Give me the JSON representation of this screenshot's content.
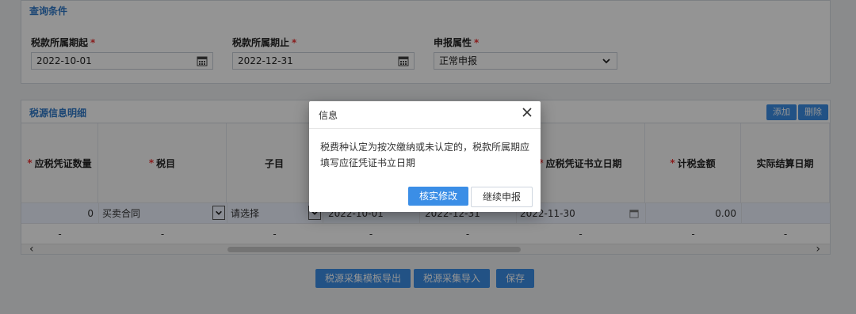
{
  "query": {
    "title": "查询条件",
    "start_label": "税款所属期起",
    "end_label": "税款所属期止",
    "attr_label": "申报属性",
    "start_value": "2022-10-01",
    "end_value": "2022-12-31",
    "attr_value": "正常申报"
  },
  "detail": {
    "title": "税源信息明细",
    "add_label": "添加",
    "delete_label": "删除",
    "columns": [
      "应税凭证数量",
      "税目",
      "子目",
      "",
      "",
      "应税凭证书立日期",
      "计税金额",
      "实际结算日期"
    ],
    "row1": {
      "qty": "0",
      "tax_item": "买卖合同",
      "sub_item": "请选择",
      "start": "2022-10-01",
      "end": "2022-12-31",
      "date": "2022-11-30",
      "amount": "0.00"
    },
    "row2_placeholder": "-"
  },
  "footer": {
    "export_template": "税源采集模板导出",
    "import": "税源采集导入",
    "save": "保存"
  },
  "modal": {
    "title": "信息",
    "message": "税费种认定为按次缴纳或未认定的，税款所属期应填写应征凭证书立日期",
    "confirm": "核实修改",
    "continue": "继续申报"
  },
  "colors": {
    "accent": "#3b8ee6",
    "required": "#ee3333",
    "title_blue": "#2f79c8"
  }
}
